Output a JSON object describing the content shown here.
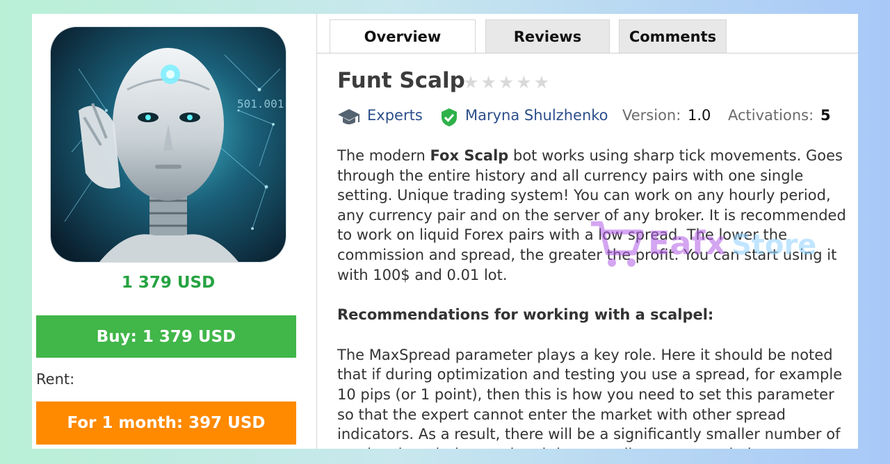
{
  "tabs": [
    "Overview",
    "Reviews",
    "Comments"
  ],
  "product": {
    "title": "Funt Scalp",
    "rating_stars": 0,
    "price": "1 379 USD",
    "buy_label": "Buy: 1 379 USD",
    "rent_label": "Rent:",
    "rent_button": "For 1 month: 397 USD",
    "image_icon": "robot-portrait-image"
  },
  "meta": {
    "category": "Experts",
    "author": "Maryna Shulzhenko",
    "version_label": "Version:",
    "version_value": "1.0",
    "activations_label": "Activations:",
    "activations_value": "5"
  },
  "description": {
    "p1_prefix": "The modern ",
    "p1_bold": "Fox Scalp",
    "p1_rest": " bot works using sharp tick movements. Goes through the entire history and all currency pairs with one single setting. Unique trading system! You can work on any hourly period, any currency pair and on the server of any broker. It is recommended to work on liquid Forex pairs with a low spread. The lower the commission and spread, the greater the profit. You can start using it with 100$ and 0.01 lot.",
    "heading": "Recommendations for working with a scalpel:",
    "p2": "The MaxSpread parameter plays a key role. Here it should be noted that if during optimization and testing you use a spread, for example 10 pips (or 1 point), then this is how you need to set this parameter so that the expert cannot enter the market with other spread indicators. As a result, there will be a significantly smaller number of entries than during testing, it is generally recommended to set"
  },
  "watermark": {
    "text": "Eafx Store"
  },
  "colors": {
    "buy": "#41b649",
    "rent": "#ff8a00",
    "price": "#26a341",
    "link": "#2c4e8a"
  }
}
